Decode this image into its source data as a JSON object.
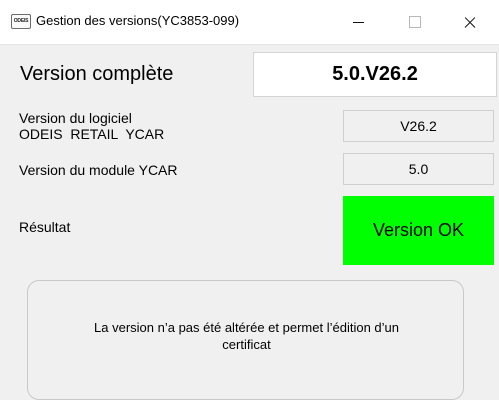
{
  "window": {
    "icon_text": "ODEIS",
    "title": "Gestion des versions(YC3853-099)"
  },
  "full_version": {
    "label": "Version complète",
    "value": "5.0.V26.2"
  },
  "software_version": {
    "label_line1": "Version du logiciel",
    "label_line2": "ODEIS  RETAIL  YCAR",
    "value": "V26.2"
  },
  "module_version": {
    "label": "Version du module YCAR",
    "value": "5.0"
  },
  "result": {
    "label": "Résultat",
    "value": "Version OK",
    "color": "#00ff00"
  },
  "message": {
    "line1": "La version n’a pas été altérée et permet l’édition d’un",
    "line2": "certificat"
  }
}
